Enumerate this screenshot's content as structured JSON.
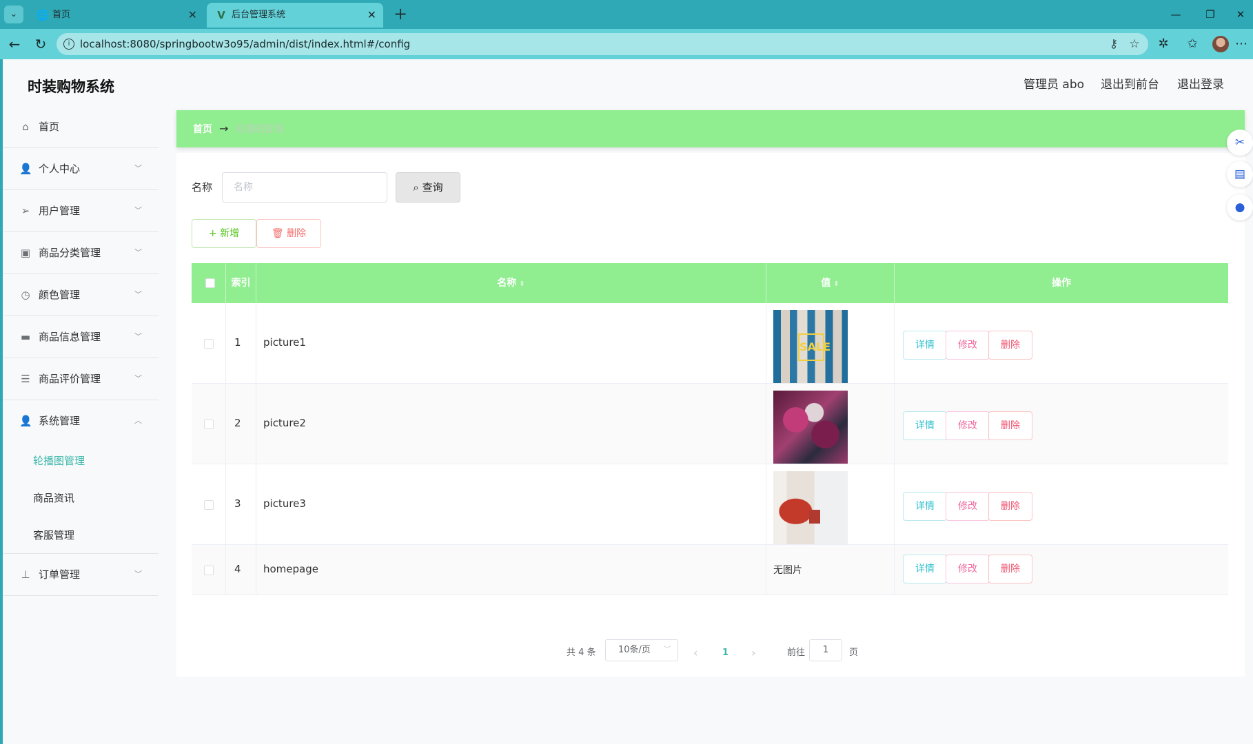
{
  "browser": {
    "tabs": [
      {
        "title": "首页",
        "icon": "globe-icon"
      },
      {
        "title": "后台管理系统",
        "icon": "vue-logo-icon"
      }
    ],
    "url": "localhost:8080/springbootw3o95/admin/dist/index.html#/config"
  },
  "header": {
    "app_title": "时装购物系统",
    "user": "管理员 abo",
    "to_front": "退出到前台",
    "logout": "退出登录"
  },
  "sidebar": {
    "items": [
      {
        "label": "首页",
        "icon": "home-icon"
      },
      {
        "label": "个人中心",
        "icon": "user-icon"
      },
      {
        "label": "用户管理",
        "icon": "send-icon"
      },
      {
        "label": "商品分类管理",
        "icon": "clipboard-icon"
      },
      {
        "label": "颜色管理",
        "icon": "clock-icon"
      },
      {
        "label": "商品信息管理",
        "icon": "message-icon"
      },
      {
        "label": "商品评价管理",
        "icon": "list-icon"
      },
      {
        "label": "系统管理",
        "icon": "user-icon"
      },
      {
        "label": "订单管理",
        "icon": "stamp-icon"
      }
    ],
    "system_children": [
      "轮播图管理",
      "商品资讯",
      "客服管理"
    ]
  },
  "breadcrumb": {
    "home": "首页",
    "current": "轮播图管理"
  },
  "search": {
    "label": "名称",
    "placeholder": "名称",
    "button": "查询"
  },
  "actions": {
    "add": "新增",
    "delete": "删除"
  },
  "table": {
    "headers": {
      "index": "索引",
      "name": "名称",
      "value": "值",
      "operation": "操作"
    },
    "rows": [
      {
        "index": "1",
        "name": "picture1",
        "value_image": "sale-banner"
      },
      {
        "index": "2",
        "name": "picture2",
        "value_image": "floral-banner"
      },
      {
        "index": "3",
        "name": "picture3",
        "value_image": "red-dress-banner"
      },
      {
        "index": "4",
        "name": "homepage",
        "value_text": "无图片"
      }
    ],
    "op_labels": {
      "detail": "详情",
      "edit": "修改",
      "delete": "删除"
    }
  },
  "pagination": {
    "total": "共 4 条",
    "page_size": "10条/页",
    "current_page": "1",
    "goto_label": "前往",
    "goto_value": "1",
    "page_suffix": "页"
  },
  "colors": {
    "accent_green": "#90ee90",
    "browser_teal": "#2fa9b5",
    "active_menu": "#3cb8a9"
  }
}
